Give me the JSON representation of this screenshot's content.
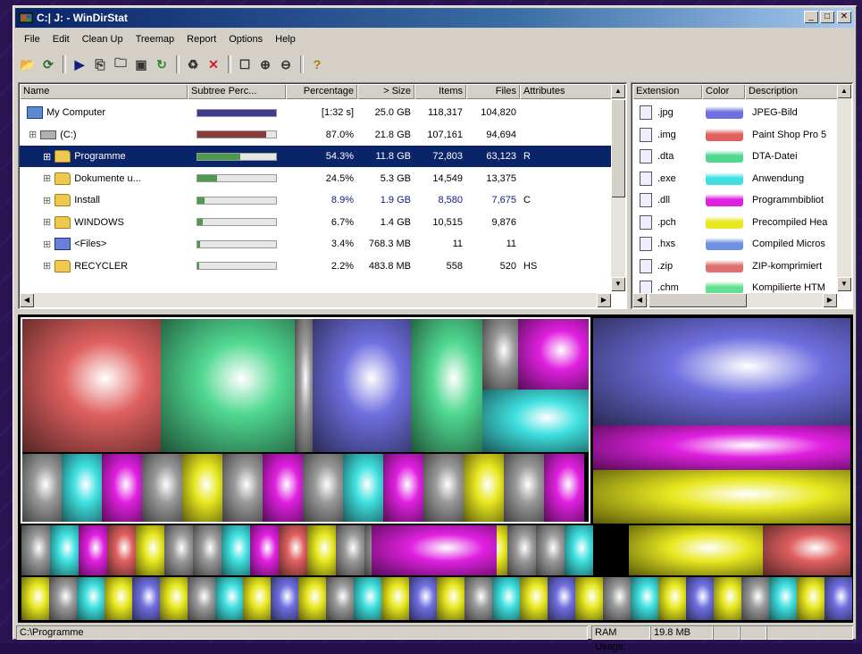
{
  "window": {
    "title": "C:| J: - WinDirStat"
  },
  "menu": [
    "File",
    "Edit",
    "Clean Up",
    "Treemap",
    "Report",
    "Options",
    "Help"
  ],
  "toolbar": [
    "open-icon",
    "refresh-icon",
    "play-icon",
    "copy-icon",
    "explorer-icon",
    "cmd-icon",
    "refresh-all-icon",
    "recycle-icon",
    "delete-icon",
    "properties-icon",
    "zoom-in-icon",
    "zoom-out-icon",
    "help-icon"
  ],
  "tree": {
    "columns": [
      "Name",
      "Subtree Perc...",
      "Percentage",
      "> Size",
      "Items",
      "Files",
      "Attributes"
    ],
    "rows": [
      {
        "name": "My Computer",
        "percentage": "[1:32 s]",
        "size": "25.0 GB",
        "items": "118,317",
        "files": "104,820",
        "attributes": "",
        "bar": 1.0,
        "barColor": "#3b3b8f",
        "selected": false,
        "indent": 0,
        "icon": "computer-icon"
      },
      {
        "name": "(C:)",
        "percentage": "87.0%",
        "size": "21.8 GB",
        "items": "107,161",
        "files": "94,694",
        "attributes": "",
        "bar": 0.87,
        "barColor": "#8b3a3a",
        "selected": false,
        "indent": 1,
        "icon": "drive-icon"
      },
      {
        "name": "Programme",
        "percentage": "54.3%",
        "size": "11.8 GB",
        "items": "72,803",
        "files": "63,123",
        "attributes": "R",
        "bar": 0.543,
        "barColor": "#4c9a4c",
        "selected": true,
        "indent": 2,
        "icon": "folder-icon"
      },
      {
        "name": "Dokumente u...",
        "percentage": "24.5%",
        "size": "5.3 GB",
        "items": "14,549",
        "files": "13,375",
        "attributes": "",
        "bar": 0.245,
        "barColor": "#4c9a4c",
        "selected": false,
        "indent": 2,
        "icon": "folder-icon"
      },
      {
        "name": "Install",
        "percentage": "8.9%",
        "size": "1.9 GB",
        "items": "8,580",
        "files": "7,675",
        "attributes": "C",
        "bar": 0.089,
        "barColor": "#4c9a4c",
        "selected": false,
        "indent": 2,
        "icon": "folder-icon"
      },
      {
        "name": "WINDOWS",
        "percentage": "6.7%",
        "size": "1.4 GB",
        "items": "10,515",
        "files": "9,876",
        "attributes": "",
        "bar": 0.067,
        "barColor": "#4c9a4c",
        "selected": false,
        "indent": 2,
        "icon": "folder-icon"
      },
      {
        "name": "<Files>",
        "percentage": "3.4%",
        "size": "768.3 MB",
        "items": "11",
        "files": "11",
        "attributes": "",
        "bar": 0.034,
        "barColor": "#4c9a4c",
        "selected": false,
        "indent": 2,
        "icon": "files-icon"
      },
      {
        "name": "RECYCLER",
        "percentage": "2.2%",
        "size": "483.8 MB",
        "items": "558",
        "files": "520",
        "attributes": "HS",
        "bar": 0.022,
        "barColor": "#4c9a4c",
        "selected": false,
        "indent": 2,
        "icon": "folder-icon"
      }
    ]
  },
  "extensions": {
    "columns": [
      "Extension",
      "Color",
      "Description"
    ],
    "rows": [
      {
        "ext": ".jpg",
        "color": "#6f6fe0",
        "desc": "JPEG-Bild"
      },
      {
        "ext": ".img",
        "color": "#e06060",
        "desc": "Paint Shop Pro 5"
      },
      {
        "ext": ".dta",
        "color": "#50d890",
        "desc": "DTA-Datei"
      },
      {
        "ext": ".exe",
        "color": "#40e0e0",
        "desc": "Anwendung"
      },
      {
        "ext": ".dll",
        "color": "#e020e0",
        "desc": "Programmbibliot"
      },
      {
        "ext": ".pch",
        "color": "#e8e820",
        "desc": "Precompiled Hea"
      },
      {
        "ext": ".hxs",
        "color": "#6f8fe0",
        "desc": "Compiled Micros"
      },
      {
        "ext": ".zip",
        "color": "#e07070",
        "desc": "ZIP-komprimiert"
      },
      {
        "ext": ".chm",
        "color": "#60e090",
        "desc": "Kompilierte HTM"
      }
    ]
  },
  "status": {
    "path": "C:\\Programme",
    "ram_label": "RAM Usage:",
    "ram_value": "19.8 MB"
  }
}
